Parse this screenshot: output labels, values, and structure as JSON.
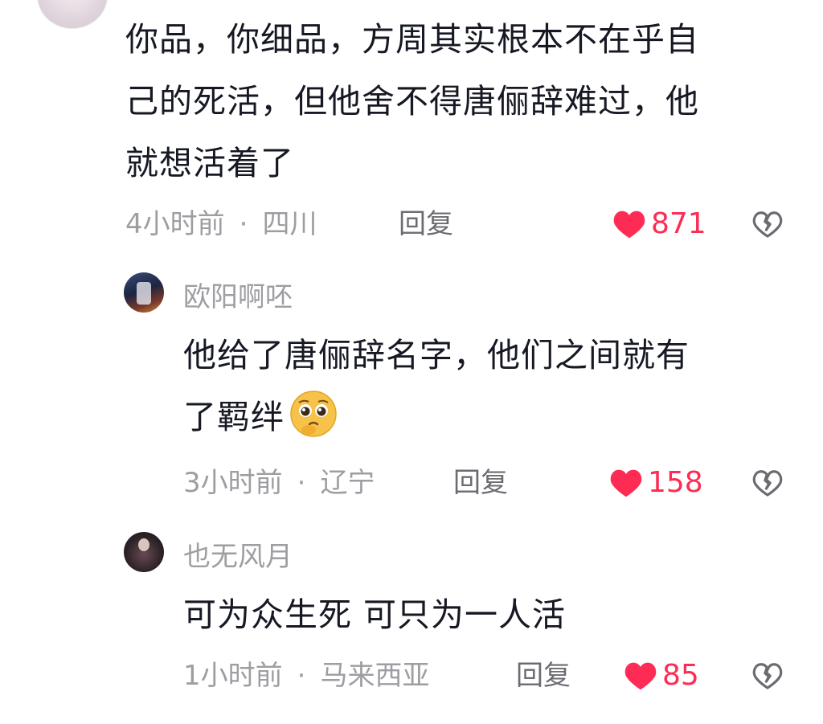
{
  "comments": [
    {
      "text_lines": [
        "你品，你细品，方周其实根本不在乎自",
        "己的死活，但他舍不得唐俪辞难过，他",
        "就想活着了"
      ],
      "time": "4小时前",
      "location": "四川",
      "reply_label": "回复",
      "likes": "871"
    },
    {
      "username": "欧阳啊呸",
      "text_lines": [
        "他给了唐俪辞名字，他们之间就有",
        "了羁绊"
      ],
      "emoji": "pleading-face-emoji",
      "time": "3小时前",
      "location": "辽宁",
      "reply_label": "回复",
      "likes": "158"
    },
    {
      "username": "也无风月",
      "text_lines": [
        "可为众生死 可只为一人活"
      ],
      "time": "1小时前",
      "location": "马来西亚",
      "reply_label": "回复",
      "likes": "85"
    }
  ],
  "separator": "·",
  "icons": {
    "like": "heart-icon",
    "dislike": "broken-heart-icon"
  },
  "colors": {
    "like_red": "#fe2c55",
    "meta_gray": "#9d9ea2",
    "text": "#161823"
  }
}
